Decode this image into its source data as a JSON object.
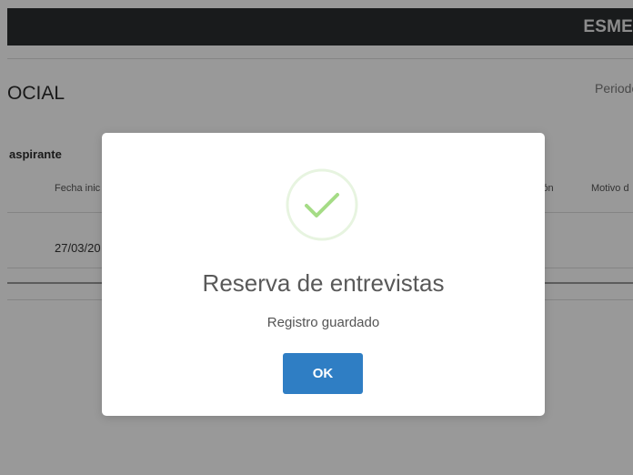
{
  "header": {
    "user_name": "ESME"
  },
  "page": {
    "title": "OCIAL",
    "period_label": "Periodo"
  },
  "section": {
    "title": "aspirante"
  },
  "table": {
    "columns": [
      "Fecha inic",
      "ión",
      "Motivo d"
    ],
    "rows": [
      {
        "fecha_inicio": "27/03/20"
      }
    ]
  },
  "modal": {
    "icon": "success-check-icon",
    "title": "Reserva de entrevistas",
    "text": "Registro guardado",
    "ok_label": "OK"
  },
  "colors": {
    "header_bg": "#2b2d30",
    "success_green": "#a5dc86",
    "button_blue": "#2f7ec4"
  }
}
